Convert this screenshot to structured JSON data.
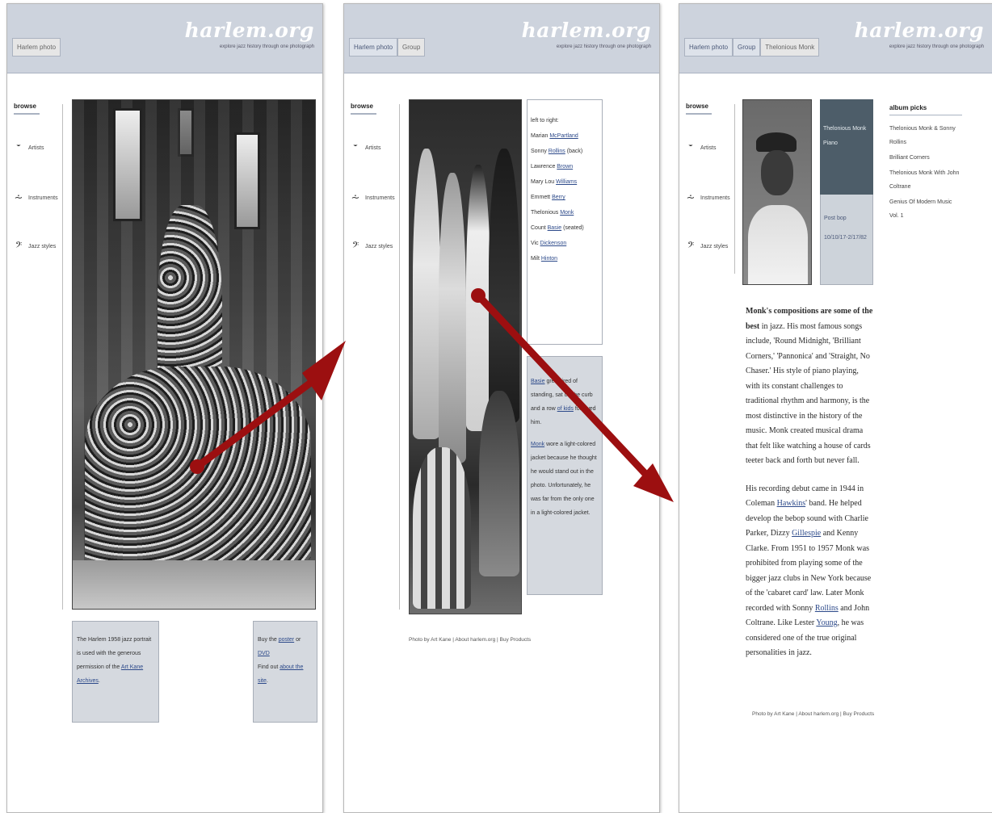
{
  "colors": {
    "arrow": "#9c0f10",
    "header_bg": "#cdd3dd",
    "info_bg": "#d5d9df",
    "bio_dark": "#4d5d69",
    "link": "#2d4a8a"
  },
  "panel1": {
    "crumbs": [
      "Harlem photo"
    ],
    "logo": "harlem.org",
    "tagline": "explore jazz history through one photograph",
    "browse": "browse",
    "nav": [
      {
        "icon": "trumpet-icon",
        "label": "Artists"
      },
      {
        "icon": "saxophone-icon",
        "label": "Instruments"
      },
      {
        "icon": "bass-clef-icon",
        "label": "Jazz styles"
      }
    ],
    "box_left": {
      "text_before": "The Harlem 1958 jazz portrait is used with the generous permission of the ",
      "link": "Art Kane Archives",
      "text_after": "."
    },
    "box_right": {
      "buy_text": "Buy the ",
      "poster": "poster",
      "or": " or ",
      "dvd": "DVD",
      "find_text": "Find out ",
      "about_link": "about the site",
      "end": "."
    }
  },
  "panel2": {
    "crumbs": [
      "Harlem photo",
      "Group"
    ],
    "logo": "harlem.org",
    "tagline": "explore jazz history through one photograph",
    "browse": "browse",
    "nav": [
      {
        "icon": "trumpet-icon",
        "label": "Artists"
      },
      {
        "icon": "saxophone-icon",
        "label": "Instruments"
      },
      {
        "icon": "bass-clef-icon",
        "label": "Jazz styles"
      }
    ],
    "names_intro": "left to right:",
    "names": [
      {
        "first": "Marian ",
        "last": "McPartland",
        "note": ""
      },
      {
        "first": "Sonny ",
        "last": "Rollins",
        "note": " (back)"
      },
      {
        "first": "Lawrence ",
        "last": "Brown",
        "note": ""
      },
      {
        "first": "Mary Lou ",
        "last": "Williams",
        "note": ""
      },
      {
        "first": "Emmett ",
        "last": "Berry",
        "note": ""
      },
      {
        "first": "Thelonious ",
        "last": "Monk",
        "note": ""
      },
      {
        "first": "Count ",
        "last": "Basie",
        "note": " (seated)"
      },
      {
        "first": "Vic ",
        "last": "Dickenson",
        "note": ""
      },
      {
        "first": "Milt ",
        "last": "Hinton",
        "note": ""
      }
    ],
    "story1": {
      "link1": "Basie",
      "t1": " grew tired of standing, sat on the curb and a row ",
      "link2": "of kids",
      "t2": " followed him."
    },
    "story2": {
      "link": "Monk",
      "t": " wore a light-colored jacket because he thought he would stand out in the photo. Unfortunately, he was far from the only one in a light-colored jacket."
    },
    "footer": "Photo by Art Kane | About harlem.org | Buy Products"
  },
  "panel3": {
    "crumbs": [
      "Harlem photo",
      "Group",
      "Thelonious Monk"
    ],
    "logo": "harlem.org",
    "tagline": "explore jazz history through one photograph",
    "browse": "browse",
    "nav": [
      {
        "icon": "trumpet-icon",
        "label": "Artists"
      },
      {
        "icon": "saxophone-icon",
        "label": "Instruments"
      },
      {
        "icon": "bass-clef-icon",
        "label": "Jazz styles"
      }
    ],
    "bio_name": "Thelonious Monk",
    "bio_instrument": "Piano",
    "bio_style": "Post bop",
    "bio_dates": "10/10/17-2/17/82",
    "picks_heading": "album picks",
    "picks": [
      "Thelonious Monk & Sonny Rollins",
      "Brilliant Corners",
      "Thelonious Monk With John Coltrane",
      "Genius Of Modern Music Vol. 1"
    ],
    "article_lead": "Monk's compositions are some of the best",
    "article_p1": " in jazz. His most famous songs include, 'Round Midnight, 'Brilliant Corners,' 'Pannonica' and 'Straight, No Chaser.' His style of piano playing, with its constant challenges to traditional rhythm and harmony, is the most distinctive in the history of the music. Monk created musical drama that felt like watching a house of cards teeter back and forth but never fall.",
    "article_p2a": "His recording debut came in 1944 in Coleman ",
    "article_p2_link1": "Hawkins",
    "article_p2b": "' band. He helped develop the bebop sound with Charlie Parker, Dizzy ",
    "article_p2_link2": "Gillespie",
    "article_p2c": " and Kenny Clarke. From 1951 to 1957 Monk was prohibited from playing some of the bigger jazz clubs in New York because of the 'cabaret card' law. Later Monk recorded with Sonny ",
    "article_p2_link3": "Rollins",
    "article_p2d": " and John Coltrane. Like Lester ",
    "article_p2_link4": "Young",
    "article_p2e": ", he was considered one of the true original personalities in jazz.",
    "footer": "Photo by Art Kane | About harlem.org | Buy Products"
  }
}
